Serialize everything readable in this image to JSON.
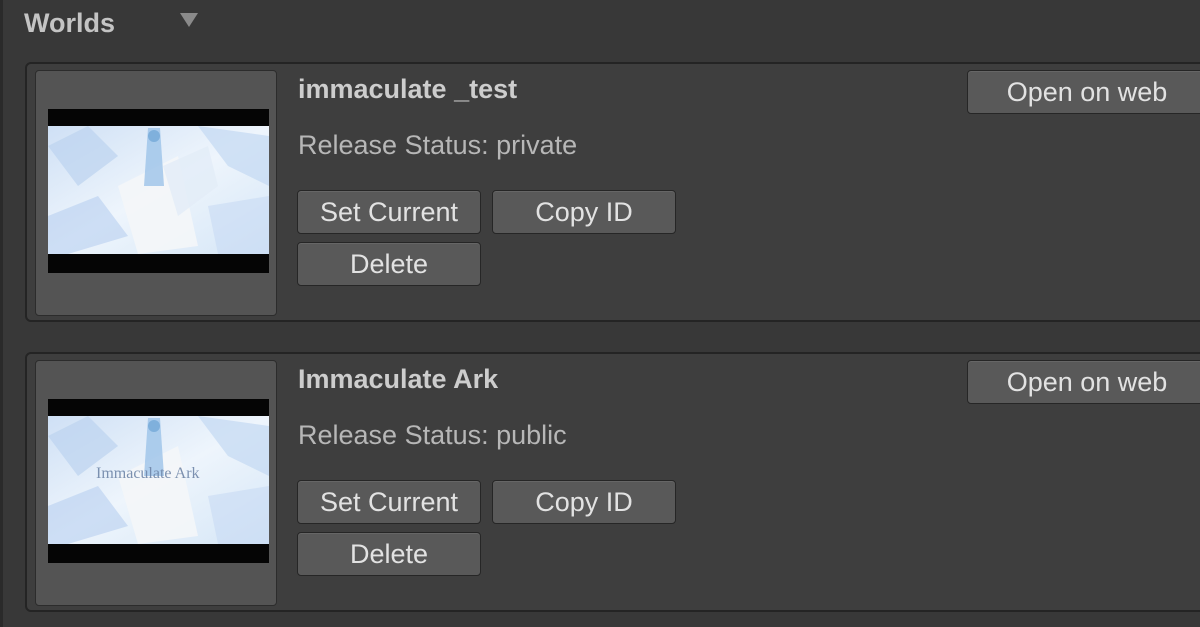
{
  "section": {
    "title": "Worlds",
    "toggle_icon": "triangle-down-icon"
  },
  "worlds": [
    {
      "name": "immaculate _test",
      "release_status": "Release Status: private",
      "thumbnail_caption": "",
      "buttons": {
        "set_current": "Set Current",
        "copy_id": "Copy ID",
        "delete": "Delete",
        "open_web": "Open on web"
      }
    },
    {
      "name": "Immaculate Ark",
      "release_status": "Release Status: public",
      "thumbnail_caption": "Immaculate Ark",
      "buttons": {
        "set_current": "Set Current",
        "copy_id": "Copy ID",
        "delete": "Delete",
        "open_web": "Open on web"
      }
    }
  ],
  "colors": {
    "background": "#383838",
    "card": "#3e3e3e",
    "button": "#595959",
    "sky": "#e9f2fb"
  }
}
